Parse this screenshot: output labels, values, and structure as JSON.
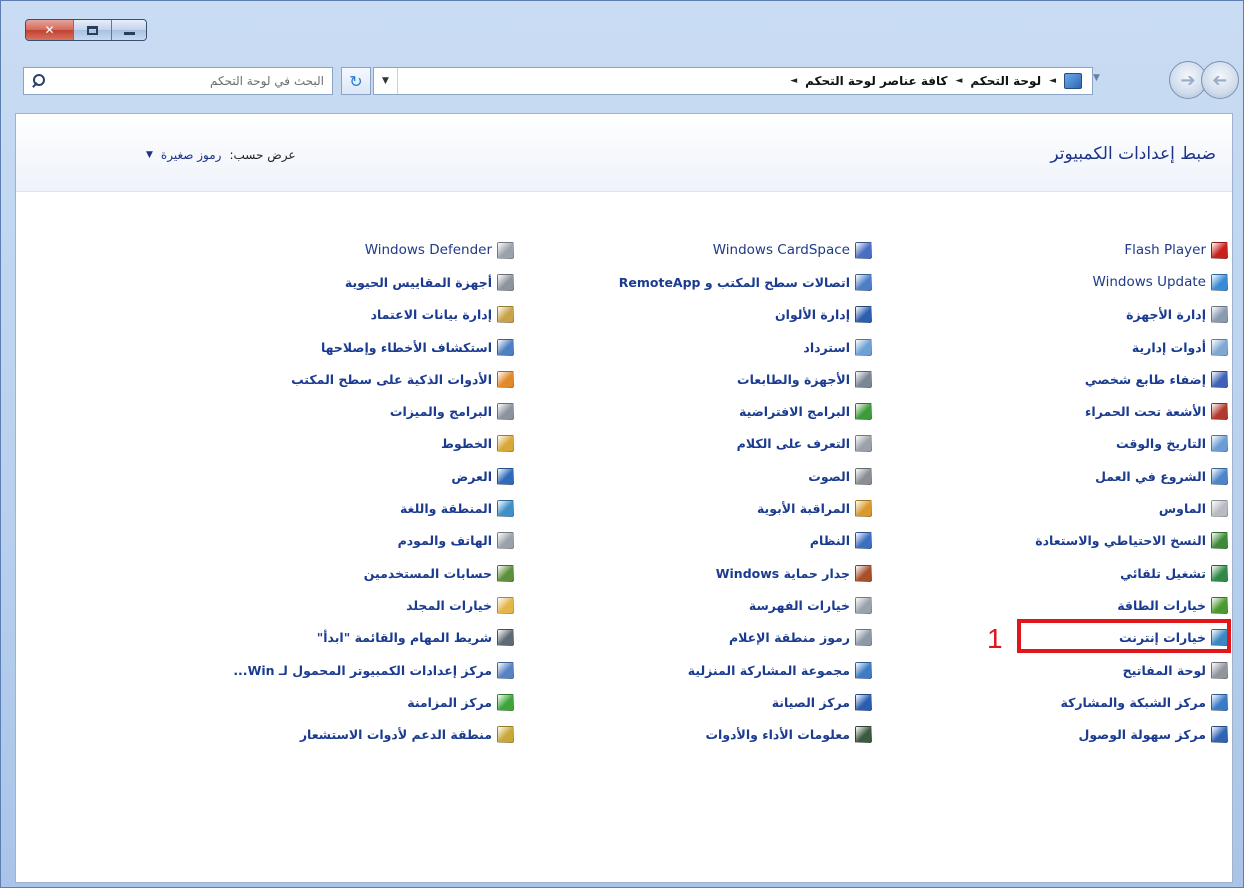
{
  "window": {
    "caption_buttons": [
      {
        "name": "close",
        "glyph": "✕"
      },
      {
        "name": "restore",
        "glyph": ""
      },
      {
        "name": "minimize",
        "glyph": ""
      }
    ]
  },
  "toolbar": {
    "search_placeholder": "البحث في لوحة التحكم",
    "refresh_glyph": "↻",
    "breadcrumb": [
      "لوحة التحكم",
      "كافة عناصر لوحة التحكم"
    ],
    "arrow_glyph": "◄",
    "dropdown_glyph": "▼"
  },
  "header": {
    "title": "ضبط إعدادات الكمبيوتر",
    "view_by_label": "عرض حسب:",
    "view_by_value": "رموز صغيرة"
  },
  "columns": {
    "right": [
      {
        "label": "Flash Player",
        "latin": true,
        "color": "#c8201a",
        "icon": "flash-player-icon"
      },
      {
        "label": "Windows Update",
        "latin": true,
        "color": "#3a8bd6",
        "icon": "windows-update-icon"
      },
      {
        "label": "إدارة الأجهزة",
        "color": "#8a9bb0",
        "icon": "device-manager-icon"
      },
      {
        "label": "أدوات إدارية",
        "color": "#7fa7d1",
        "icon": "admin-tools-icon"
      },
      {
        "label": "إضفاء طابع شخصي",
        "color": "#3d62b8",
        "icon": "personalization-icon"
      },
      {
        "label": "الأشعة تحت الحمراء",
        "color": "#b23a2c",
        "icon": "infrared-icon"
      },
      {
        "label": "التاريخ والوقت",
        "color": "#6a9dd4",
        "icon": "date-time-icon"
      },
      {
        "label": "الشروع في العمل",
        "color": "#4a86c9",
        "icon": "getting-started-icon"
      },
      {
        "label": "الماوس",
        "color": "#b8bcc2",
        "icon": "mouse-icon"
      },
      {
        "label": "النسخ الاحتياطي والاستعادة",
        "color": "#3f8a3a",
        "icon": "backup-restore-icon"
      },
      {
        "label": "تشغيل تلقائي",
        "color": "#2e8a46",
        "icon": "autoplay-icon"
      },
      {
        "label": "خيارات الطاقة",
        "color": "#4c9a2f",
        "icon": "power-options-icon"
      },
      {
        "label": "خيارات إنترنت",
        "color": "#3b86c4",
        "icon": "internet-options-icon"
      },
      {
        "label": "لوحة المفاتيح",
        "color": "#8f969e",
        "icon": "keyboard-icon"
      },
      {
        "label": "مركز الشبكة والمشاركة",
        "color": "#3a7bc8",
        "icon": "network-sharing-icon"
      },
      {
        "label": "مركز سهولة الوصول",
        "color": "#2f63b5",
        "icon": "ease-of-access-icon"
      }
    ],
    "middle": [
      {
        "label": "Windows CardSpace",
        "latin": true,
        "color": "#4a6fc0",
        "icon": "cardspace-icon"
      },
      {
        "label": "اتصالات سطح المكتب و RemoteApp",
        "color": "#4c7fc6",
        "icon": "remoteapp-icon"
      },
      {
        "label": "إدارة الألوان",
        "color": "#2d5fb0",
        "icon": "color-management-icon"
      },
      {
        "label": "استرداد",
        "color": "#6ca1d6",
        "icon": "recovery-icon"
      },
      {
        "label": "الأجهزة والطابعات",
        "color": "#7c8795",
        "icon": "devices-printers-icon"
      },
      {
        "label": "البرامج الافتراضية",
        "color": "#3e9b3a",
        "icon": "default-programs-icon"
      },
      {
        "label": "التعرف على الكلام",
        "color": "#9aa1a8",
        "icon": "speech-recognition-icon"
      },
      {
        "label": "الصوت",
        "color": "#8a8f95",
        "icon": "sound-icon"
      },
      {
        "label": "المراقبة الأبوية",
        "color": "#d89a2e",
        "icon": "parental-controls-icon"
      },
      {
        "label": "النظام",
        "color": "#3c6fbf",
        "icon": "system-icon"
      },
      {
        "label": "جدار حماية Windows",
        "color": "#a8502a",
        "icon": "firewall-icon"
      },
      {
        "label": "خيارات الفهرسة",
        "color": "#9aa3ad",
        "icon": "indexing-options-icon"
      },
      {
        "label": "رموز منطقة الإعلام",
        "color": "#8e9aa8",
        "icon": "notification-icons-icon"
      },
      {
        "label": "مجموعة المشاركة المنزلية",
        "color": "#3d7bc2",
        "icon": "homegroup-icon"
      },
      {
        "label": "مركز الصيانة",
        "color": "#2b5eb3",
        "icon": "action-center-icon"
      },
      {
        "label": "معلومات الأداء والأدوات",
        "color": "#3c5a3f",
        "icon": "performance-info-icon"
      }
    ],
    "left": [
      {
        "label": "Windows Defender",
        "latin": true,
        "color": "#9aa2ab",
        "icon": "windows-defender-icon"
      },
      {
        "label": "أجهزة المقاييس الحيوية",
        "color": "#8d949c",
        "icon": "biometric-devices-icon"
      },
      {
        "label": "إدارة بيانات الاعتماد",
        "color": "#c9a24a",
        "icon": "credential-manager-icon"
      },
      {
        "label": "استكشاف الأخطاء وإصلاحها",
        "color": "#4d7fc3",
        "icon": "troubleshooting-icon"
      },
      {
        "label": "الأدوات الذكية على سطح المكتب",
        "color": "#e08a2a",
        "icon": "desktop-gadgets-icon"
      },
      {
        "label": "البرامج والميزات",
        "color": "#8b949e",
        "icon": "programs-features-icon"
      },
      {
        "label": "الخطوط",
        "color": "#d9a736",
        "icon": "fonts-icon"
      },
      {
        "label": "العرض",
        "color": "#2f6bb8",
        "icon": "display-icon"
      },
      {
        "label": "المنطقة واللغة",
        "color": "#3f8fc9",
        "icon": "region-language-icon"
      },
      {
        "label": "الهاتف والمودم",
        "color": "#9aa3ab",
        "icon": "phone-modem-icon"
      },
      {
        "label": "حسابات المستخدمين",
        "color": "#5e8f3a",
        "icon": "user-accounts-icon"
      },
      {
        "label": "خيارات المجلد",
        "color": "#e3b64a",
        "icon": "folder-options-icon"
      },
      {
        "label": "شريط المهام والقائمة \"ابدأ\"",
        "color": "#606a75",
        "icon": "taskbar-start-menu-icon"
      },
      {
        "label": "مركز إعدادات الكمبيوتر المحمول لـ Win...",
        "color": "#5783c4",
        "icon": "mobility-center-icon"
      },
      {
        "label": "مركز المزامنة",
        "color": "#3fa53a",
        "icon": "sync-center-icon"
      },
      {
        "label": "منطقة الدعم لأدوات الاستشعار",
        "color": "#c9a73a",
        "icon": "location-sensors-icon"
      }
    ]
  },
  "annotation": {
    "step_number": "1",
    "color": "#e1161b"
  }
}
